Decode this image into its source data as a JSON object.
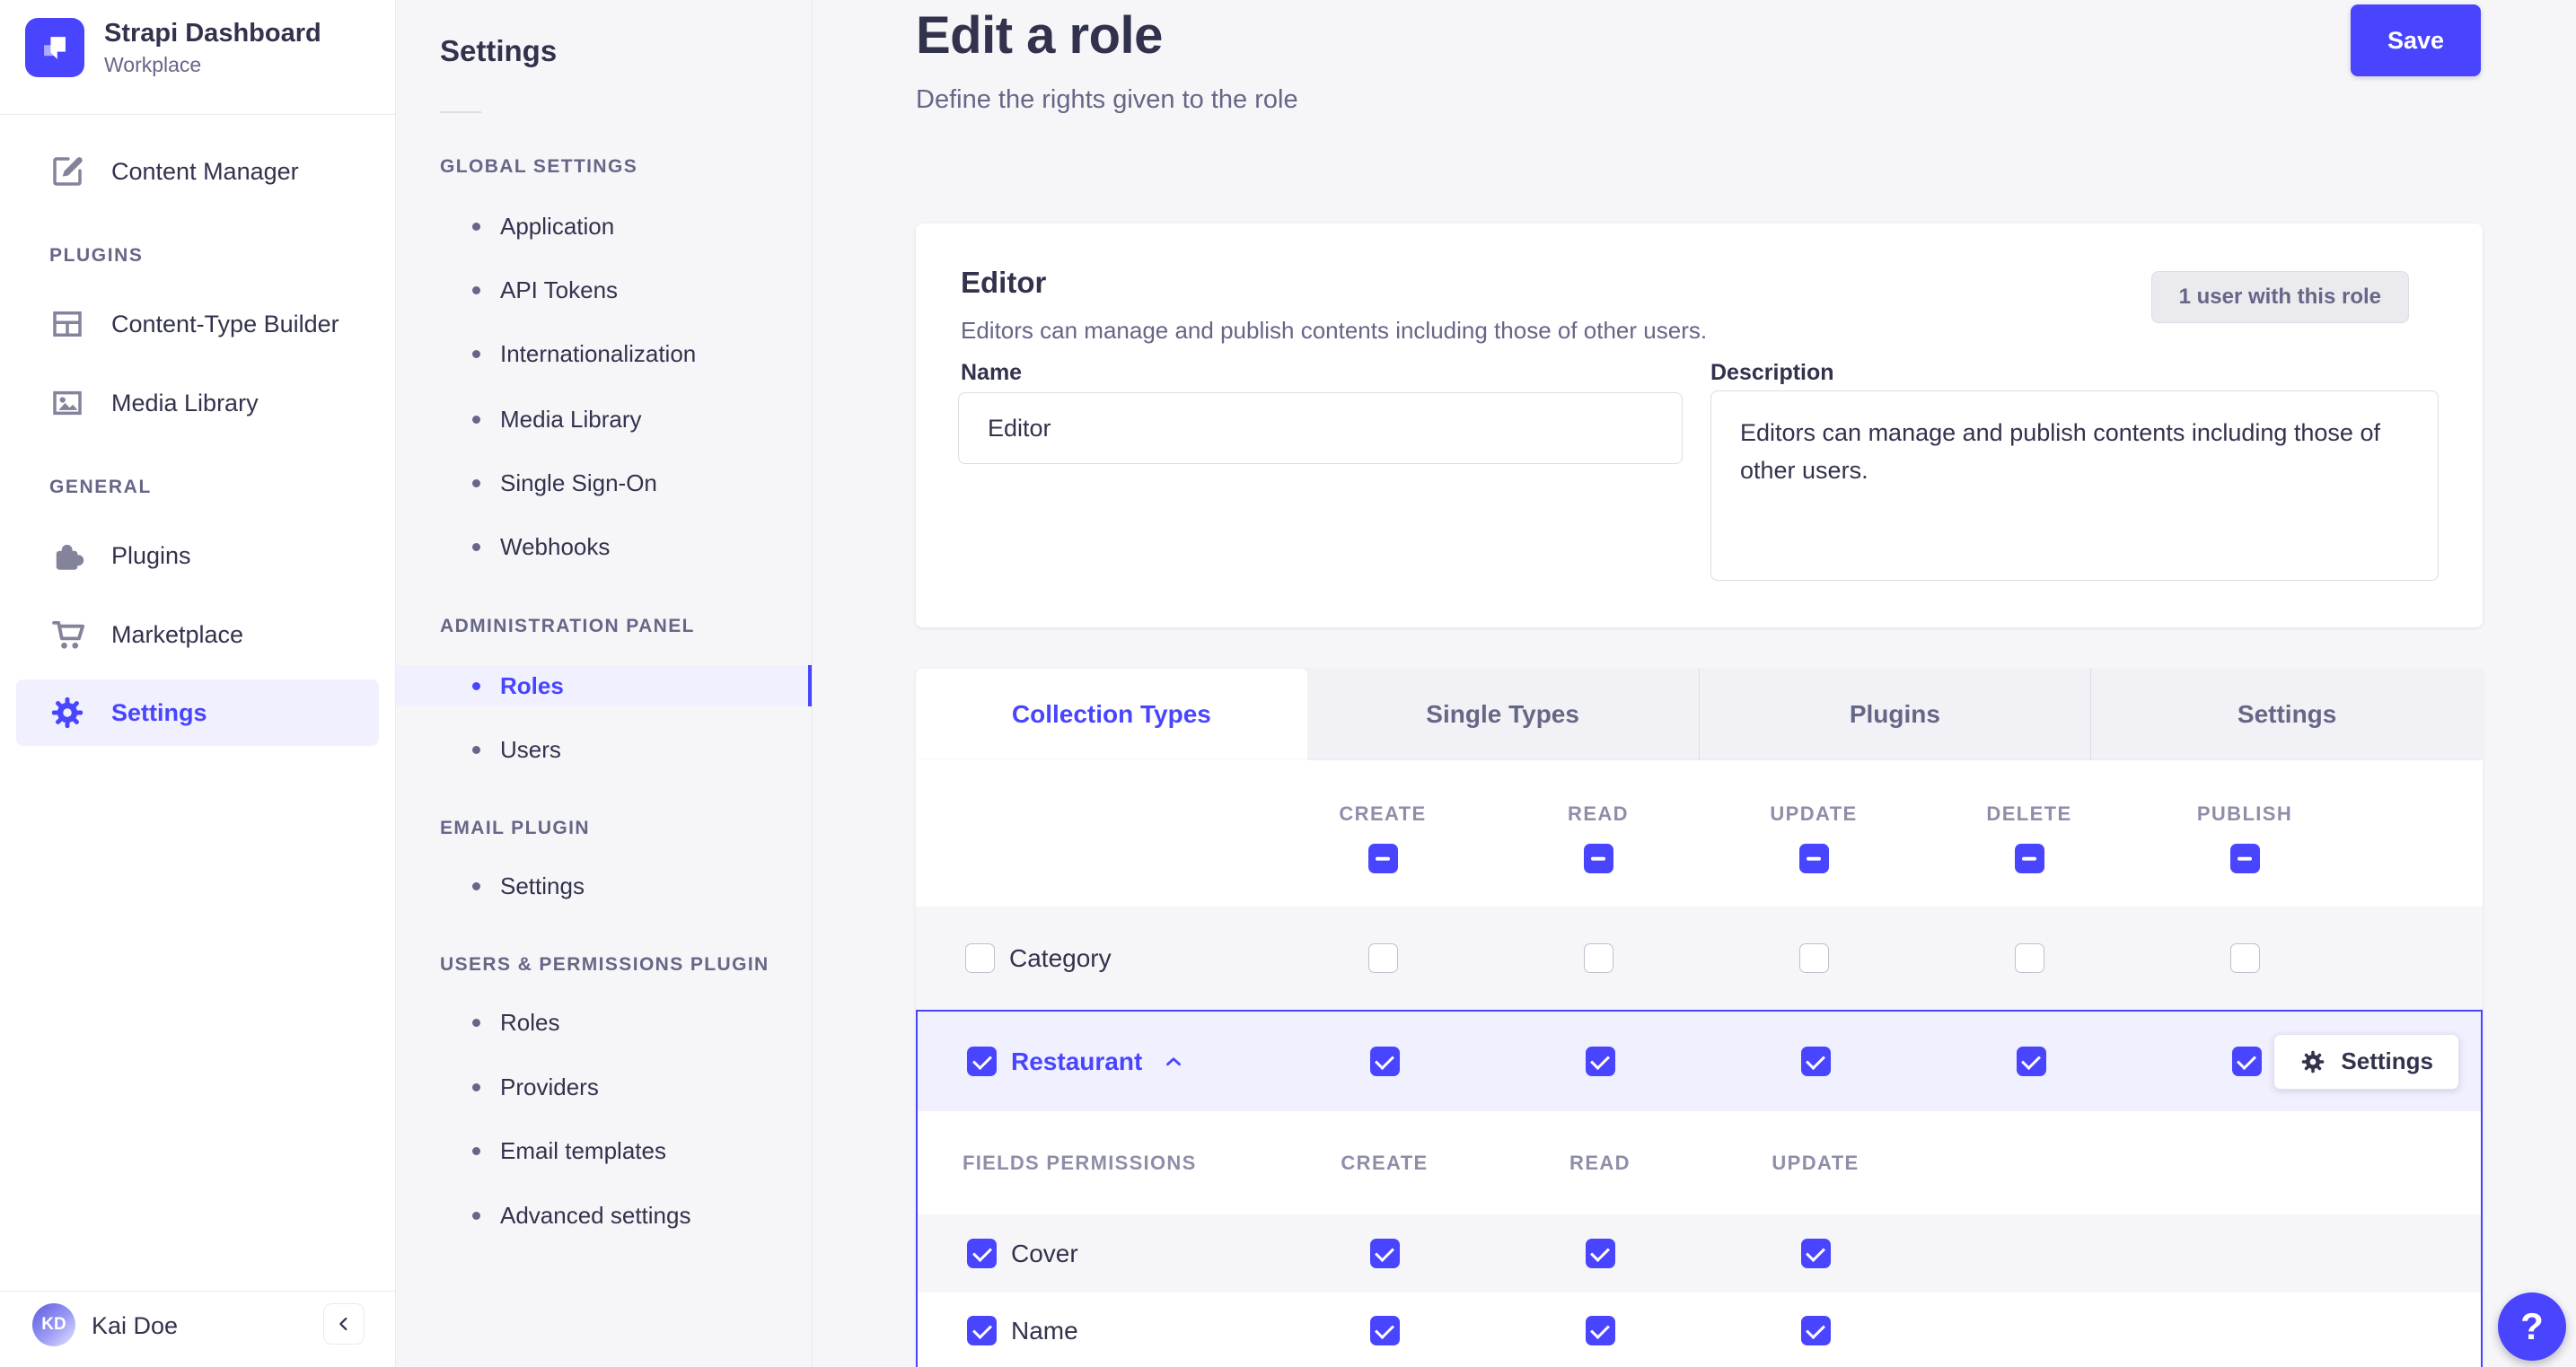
{
  "brand": {
    "title": "Strapi Dashboard",
    "workspace": "Workplace"
  },
  "nav": {
    "content_manager": "Content Manager",
    "sections": [
      {
        "title": "PLUGINS",
        "items": [
          {
            "label": "Content-Type Builder"
          },
          {
            "label": "Media Library"
          }
        ]
      },
      {
        "title": "GENERAL",
        "items": [
          {
            "label": "Plugins"
          },
          {
            "label": "Marketplace"
          },
          {
            "label": "Settings",
            "active": true
          }
        ]
      }
    ],
    "user": {
      "initials": "KD",
      "name": "Kai Doe"
    }
  },
  "subnav": {
    "title": "Settings",
    "sections": [
      {
        "title": "GLOBAL SETTINGS",
        "items": [
          {
            "label": "Application"
          },
          {
            "label": "API Tokens"
          },
          {
            "label": "Internationalization"
          },
          {
            "label": "Media Library"
          },
          {
            "label": "Single Sign-On"
          },
          {
            "label": "Webhooks"
          }
        ]
      },
      {
        "title": "ADMINISTRATION PANEL",
        "items": [
          {
            "label": "Roles",
            "active": true
          },
          {
            "label": "Users"
          }
        ]
      },
      {
        "title": "EMAIL PLUGIN",
        "items": [
          {
            "label": "Settings"
          }
        ]
      },
      {
        "title": "USERS & PERMISSIONS PLUGIN",
        "items": [
          {
            "label": "Roles"
          },
          {
            "label": "Providers"
          },
          {
            "label": "Email templates"
          },
          {
            "label": "Advanced settings"
          }
        ]
      }
    ]
  },
  "page": {
    "title": "Edit a role",
    "subtitle": "Define the rights given to the role",
    "save_label": "Save"
  },
  "role": {
    "name_heading": "Editor",
    "description_text": "Editors can manage and publish contents including those of other users.",
    "users_count_label": "1 user with this role",
    "name_label": "Name",
    "name_value": "Editor",
    "description_label": "Description",
    "description_value": "Editors can manage and publish contents including those of other users."
  },
  "permissions": {
    "tabs": [
      {
        "label": "Collection Types",
        "active": true
      },
      {
        "label": "Single Types"
      },
      {
        "label": "Plugins"
      },
      {
        "label": "Settings"
      }
    ],
    "columns": [
      "CREATE",
      "READ",
      "UPDATE",
      "DELETE",
      "PUBLISH"
    ],
    "header_checks": [
      "indeterminate",
      "indeterminate",
      "indeterminate",
      "indeterminate",
      "indeterminate"
    ],
    "rows": [
      {
        "label": "Category",
        "checkbox": "unchecked",
        "expanded": false,
        "checks": [
          "unchecked",
          "unchecked",
          "unchecked",
          "unchecked",
          "unchecked"
        ]
      },
      {
        "label": "Restaurant",
        "checkbox": "checked",
        "expanded": true,
        "settings_label": "Settings",
        "checks": [
          "checked",
          "checked",
          "checked",
          "checked",
          "checked"
        ]
      }
    ],
    "fields": {
      "title": "FIELDS PERMISSIONS",
      "columns": [
        "CREATE",
        "READ",
        "UPDATE"
      ],
      "rows": [
        {
          "label": "Cover",
          "checkbox": "checked",
          "checks": [
            "checked",
            "checked",
            "checked"
          ]
        },
        {
          "label": "Name",
          "checkbox": "checked",
          "checks": [
            "checked",
            "checked",
            "checked"
          ]
        }
      ]
    }
  },
  "help": {
    "label": "?"
  },
  "colors": {
    "accent": "#4945ff",
    "accent_light": "#f0f0ff",
    "text": "#32324d",
    "text_muted": "#666687",
    "border": "#eaeaef",
    "background": "#f6f6f9"
  }
}
